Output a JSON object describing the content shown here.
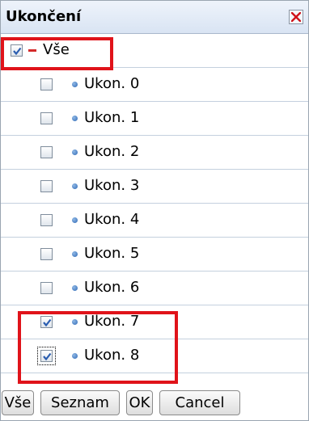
{
  "dialog": {
    "title": "Ukončení",
    "close_icon": "close-icon"
  },
  "all_row": {
    "label": "Vše",
    "checked": true
  },
  "items": [
    {
      "label": "Ukon. 0",
      "checked": false
    },
    {
      "label": "Ukon. 1",
      "checked": false
    },
    {
      "label": "Ukon. 2",
      "checked": false
    },
    {
      "label": "Ukon. 3",
      "checked": false
    },
    {
      "label": "Ukon. 4",
      "checked": false
    },
    {
      "label": "Ukon. 5",
      "checked": false
    },
    {
      "label": "Ukon. 6",
      "checked": false
    },
    {
      "label": "Ukon. 7",
      "checked": true
    },
    {
      "label": "Ukon. 8",
      "checked": true
    }
  ],
  "buttons": {
    "all": "Vše",
    "list": "Seznam",
    "ok": "OK",
    "cancel": "Cancel"
  },
  "colors": {
    "highlight": "#e0131a",
    "check": "#2a5db0",
    "bullet": "#2f69b4",
    "dash": "#d42a2a"
  }
}
